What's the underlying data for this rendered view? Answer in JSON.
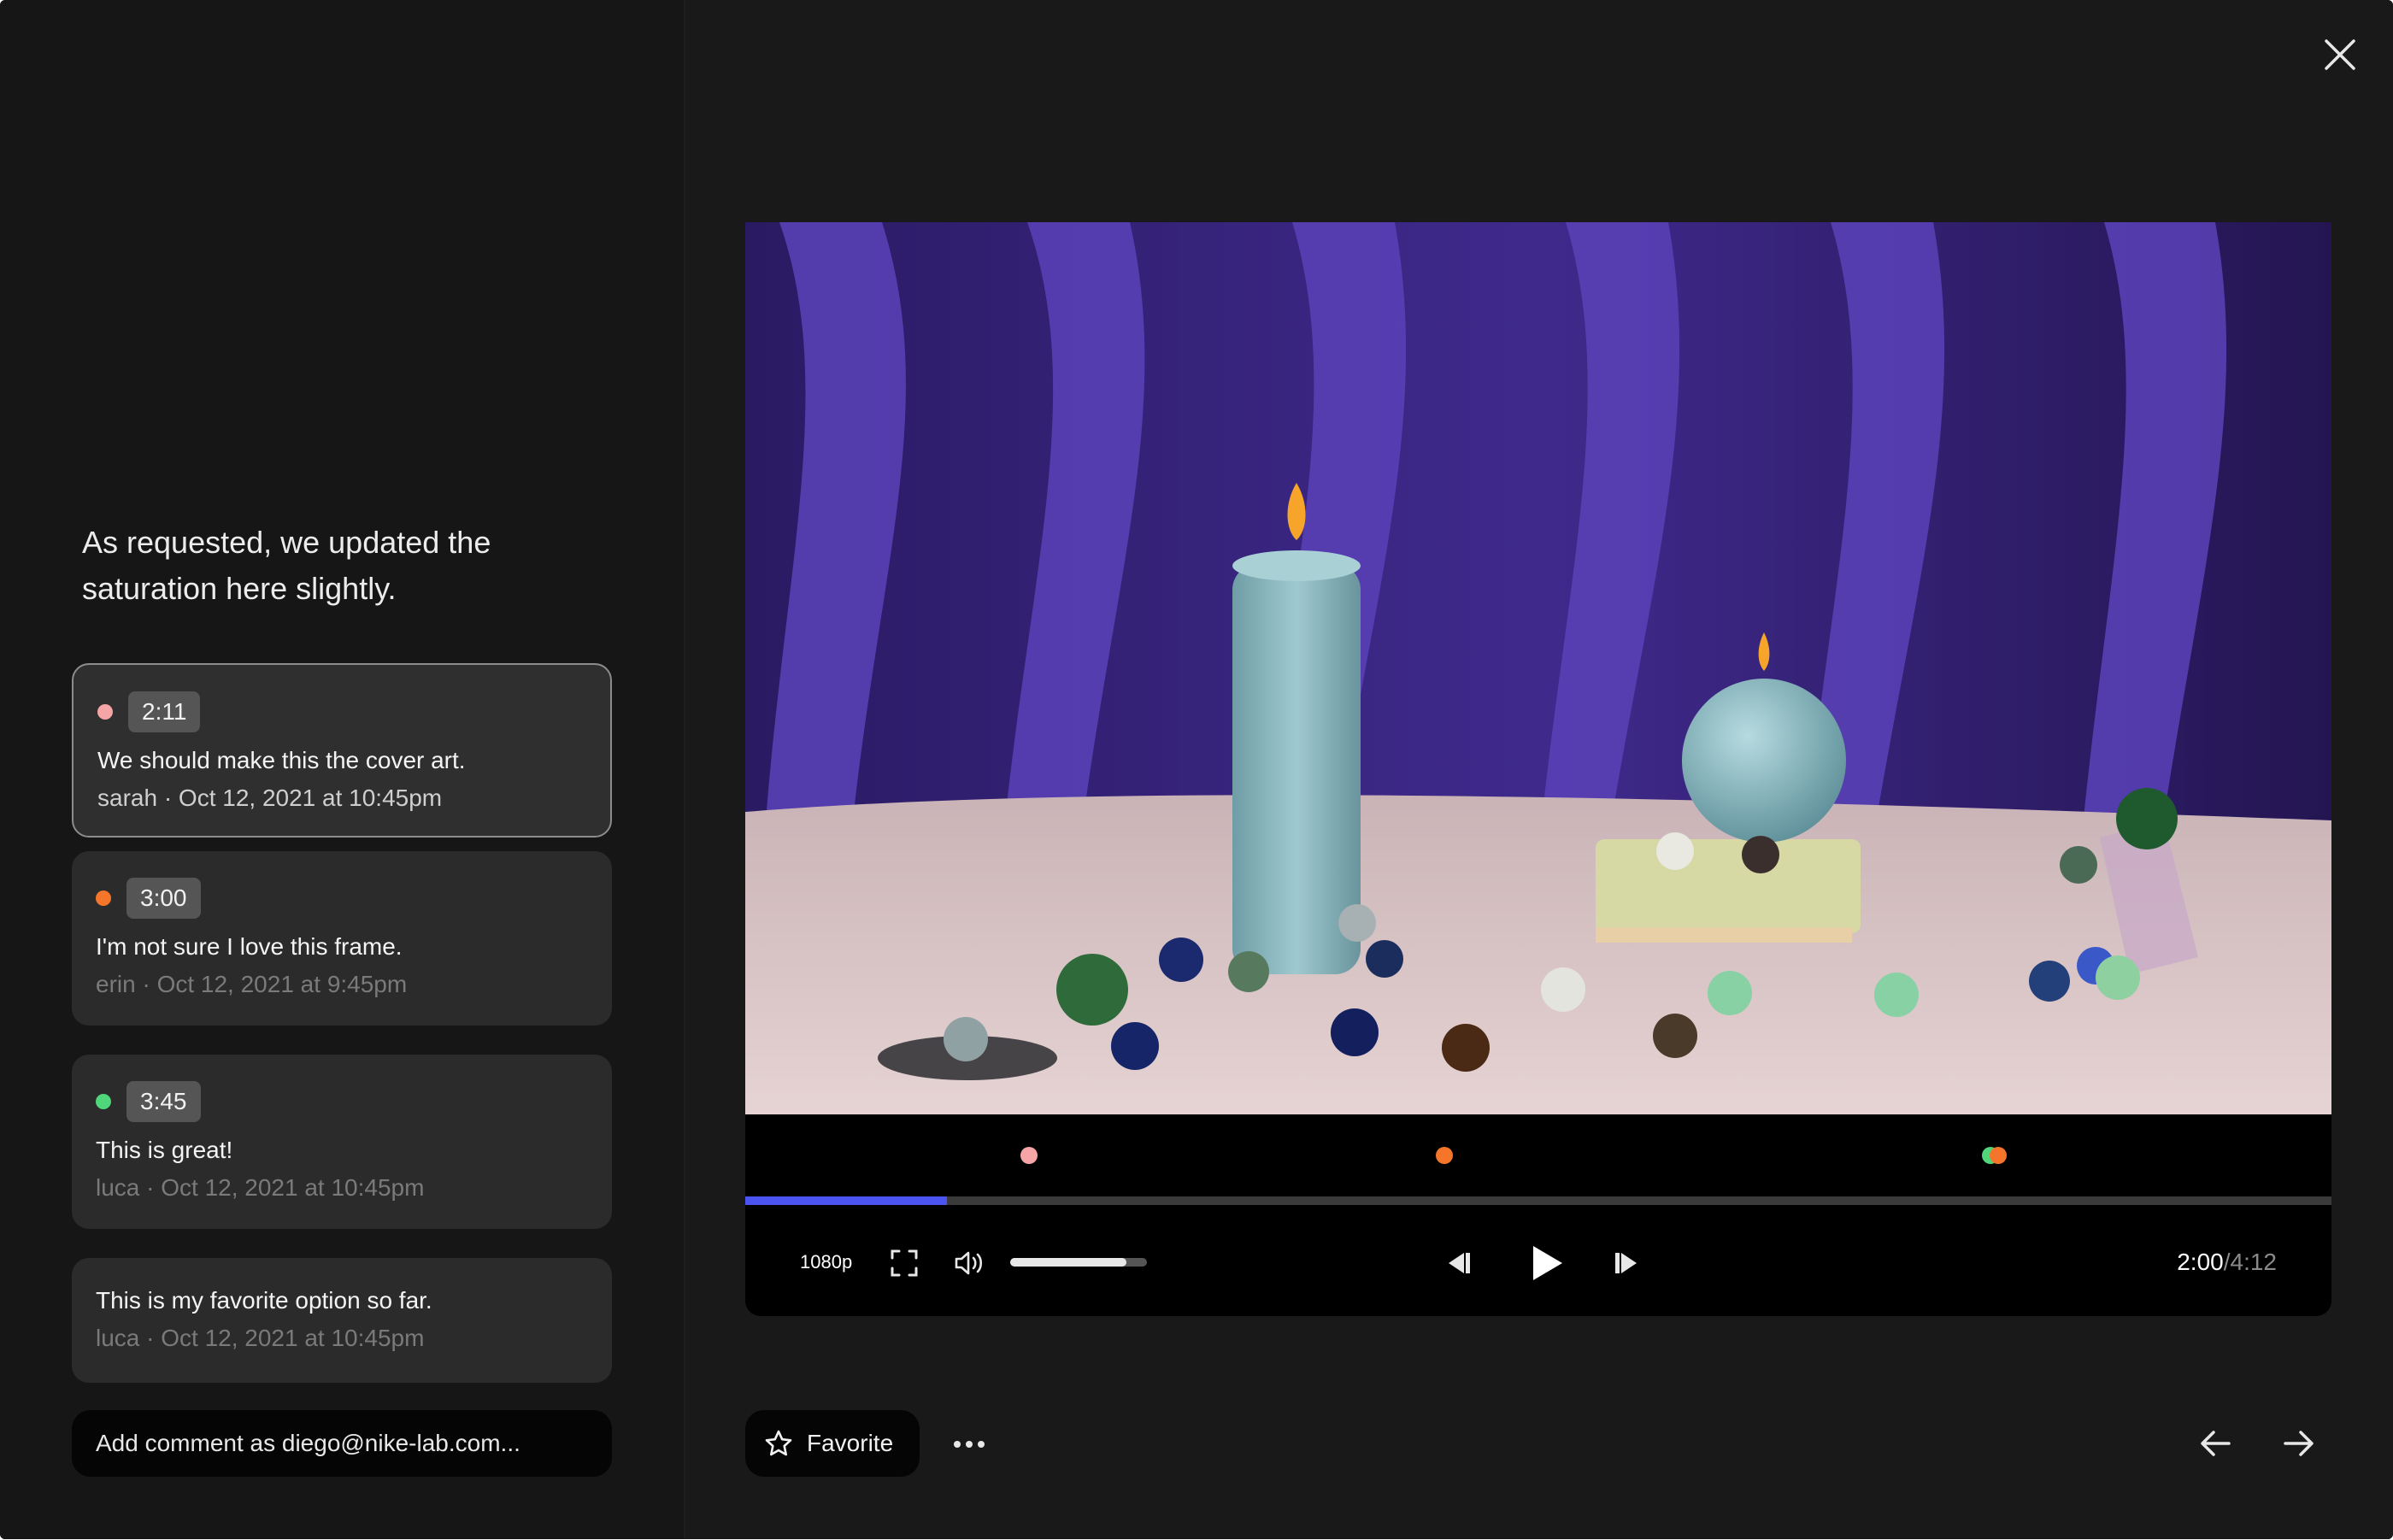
{
  "caption": "As requested, we updated the saturation here slightly.",
  "comments": [
    {
      "time": "2:11",
      "dot_color": "#f6a5a6",
      "text": "We should make this the cover art.",
      "meta": "sarah · Oct 12, 2021 at 10:45pm",
      "active": true
    },
    {
      "time": "3:00",
      "dot_color": "#f5762a",
      "text": "I'm not sure I love this frame.",
      "meta": "erin · Oct 12, 2021 at 9:45pm"
    },
    {
      "time": "3:45",
      "dot_color": "#4fd67a",
      "text": "This is great!",
      "meta": "luca · Oct 12, 2021 at 10:45pm"
    },
    {
      "text": "This is my favorite option so far.",
      "meta": "luca · Oct 12, 2021 at 10:45pm"
    }
  ],
  "add_comment": {
    "placeholder": "Add comment as diego@nike-lab.com..."
  },
  "player": {
    "quality": "1080p",
    "current_time": "2:00",
    "total_time": "/4:12",
    "progress": 0.127,
    "volume": 0.85,
    "accent_color": "#4b53f0",
    "markers": [
      {
        "position": 0.179,
        "color": "#f6a5a6"
      },
      {
        "position": 0.441,
        "color": "#f5762a"
      },
      {
        "position": 0.785,
        "color": "#4fd67a"
      },
      {
        "position": 0.79,
        "color": "#f5762a"
      }
    ]
  },
  "actions": {
    "favorite_label": "Favorite"
  },
  "icons": [
    "close-icon",
    "fullscreen-icon",
    "volume-icon",
    "skip-back-icon",
    "play-icon",
    "skip-forward-icon",
    "star-icon",
    "more-icon",
    "arrow-left-icon",
    "arrow-right-icon"
  ]
}
